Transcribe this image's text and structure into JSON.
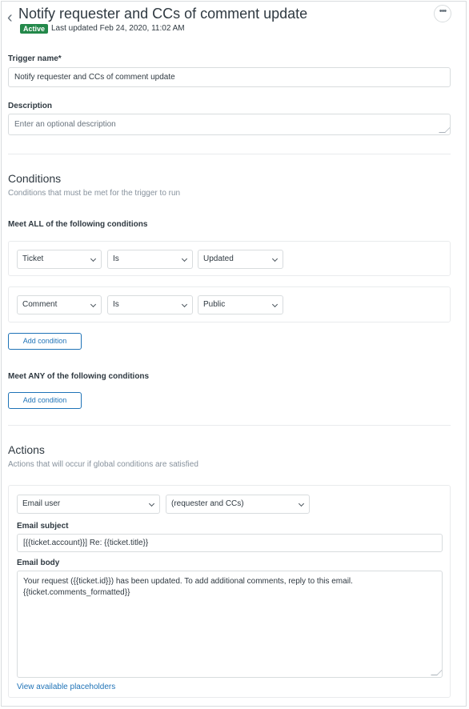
{
  "header": {
    "title": "Notify requester and CCs of comment update",
    "status_badge": "Active",
    "last_updated": "Last updated Feb 24, 2020, 11:02 AM"
  },
  "trigger_name": {
    "label": "Trigger name*",
    "value": "Notify requester and CCs of comment update"
  },
  "description": {
    "label": "Description",
    "placeholder": "Enter an optional description"
  },
  "conditions": {
    "heading": "Conditions",
    "subtitle": "Conditions that must be met for the trigger to run",
    "all_label": "Meet ALL of the following conditions",
    "all_rows": [
      {
        "field": "Ticket",
        "operator": "Is",
        "value": "Updated"
      },
      {
        "field": "Comment",
        "operator": "Is",
        "value": "Public"
      }
    ],
    "add_all_label": "Add condition",
    "any_label": "Meet ANY of the following conditions",
    "add_any_label": "Add condition"
  },
  "actions": {
    "heading": "Actions",
    "subtitle": "Actions that will occur if global conditions are satisfied",
    "action_type": "Email user",
    "recipient": "(requester and CCs)",
    "subject_label": "Email subject",
    "subject_value": "[{{ticket.account}}] Re: {{ticket.title}}",
    "body_label": "Email body",
    "body_value": "Your request ({{ticket.id}}) has been updated. To add additional comments, reply to this email. {{ticket.comments_formatted}}",
    "placeholders_link": "View available placeholders"
  },
  "colors": {
    "accent": "#1f73b7",
    "active_badge": "#23884a",
    "border": "#d8dcde"
  }
}
